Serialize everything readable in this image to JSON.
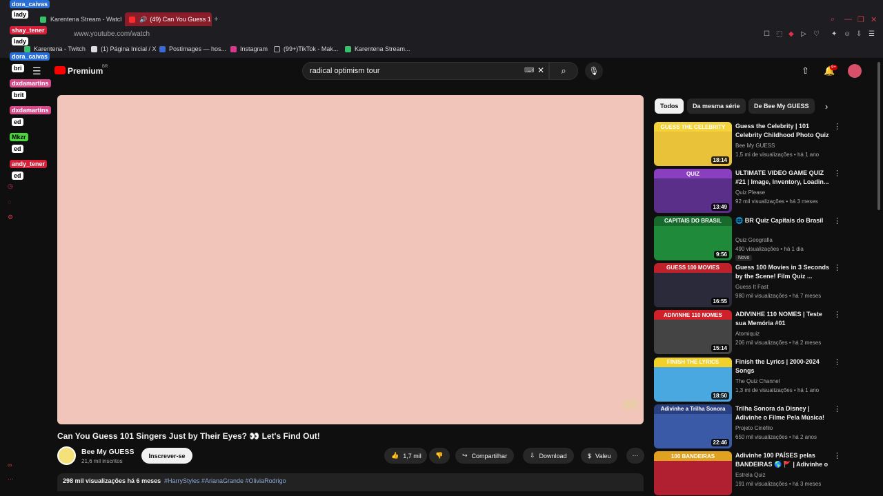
{
  "browser": {
    "tabs": [
      {
        "label": "Karentena Stream - Watch"
      },
      {
        "label": "(49) Can You Guess 1"
      }
    ],
    "new_tab": "+",
    "url": "www.youtube.com/watch",
    "bookmarks": [
      {
        "label": "Karentena - Twitch"
      },
      {
        "label": "(1) Página Inicial / X"
      },
      {
        "label": "Postimages — hos..."
      },
      {
        "label": "Instagram"
      },
      {
        "label": "(99+)TikTok - Mak..."
      },
      {
        "label": "Karentena Stream..."
      }
    ]
  },
  "yt": {
    "logo_text": "Premium",
    "logo_region": "BR",
    "search_value": "radical optimism tour",
    "notif_count": "9+"
  },
  "video": {
    "title": "Can You Guess 101 Singers Just by Their Eyes? 👀 Let's Find Out!",
    "channel": "Bee My GUESS",
    "subs": "21,6 mil inscritos",
    "subscribe": "Inscrever-se",
    "likes": "1,7 mil",
    "share": "Compartilhar",
    "download": "Download",
    "thanks": "Valeu",
    "views_line": "298 mil visualizações  há 6 meses",
    "tags": "#HarryStyles #ArianaGrande #OliviaRodrigo"
  },
  "chips": [
    "Todos",
    "Da mesma série",
    "De Bee My GUESS"
  ],
  "recs": [
    {
      "title": "Guess the Celebrity | 101 Celebrity Childhood Photo Quiz",
      "channel": "Bee My GUESS",
      "meta": "1,5 mi de visualizações • há 1 ano",
      "dur": "18:14",
      "thumb_label": "GUESS THE CELEBRITY",
      "color": "#e9c23a",
      "band": "#f4d23a"
    },
    {
      "title": "ULTIMATE VIDEO GAME QUIZ #21 | Image, Inventory, Loadin...",
      "channel": "Quiz Please",
      "meta": "92 mil visualizações • há 3 meses",
      "dur": "13:49",
      "thumb_label": "QUIZ",
      "color": "#5a2f8a",
      "band": "#8a3fc0"
    },
    {
      "title": "🌐 BR Quiz Capitais do Brasil",
      "channel": "Quiz Geografia",
      "meta": "490 visualizações • há 1 dia",
      "dur": "9:56",
      "thumb_label": "CAPITAIS DO BRASIL",
      "color": "#1f8a3a",
      "band": "#176a2c",
      "new": "Novo"
    },
    {
      "title": "Guess 100 Movies in 3 Seconds by the Scene! Film Quiz ...",
      "channel": "Guess It Fast",
      "meta": "980 mil visualizações • há 7 meses",
      "dur": "16:55",
      "thumb_label": "GUESS 100 MOVIES",
      "color": "#2a2a3a",
      "band": "#c0202a"
    },
    {
      "title": "ADIVINHE 110 NOMES | Teste sua Memória #01",
      "channel": "Atomiquiz",
      "meta": "206 mil visualizações • há 2 meses",
      "dur": "15:14",
      "thumb_label": "ADIVINHE 110 NOMES",
      "color": "#444",
      "band": "#d0202a"
    },
    {
      "title": "Finish the Lyrics | 2000-2024 Songs",
      "channel": "The Quiz Channel",
      "meta": "1,3 mi de visualizações • há 1 ano",
      "dur": "18:50",
      "thumb_label": "FINISH THE LYRICS",
      "color": "#4aa8e0",
      "band": "#f2d12a"
    },
    {
      "title": "Trilha Sonora da Disney | Adivinhe o Filme Pela Música!",
      "channel": "Projeto Cinéfilo",
      "meta": "650 mil visualizações • há 2 anos",
      "dur": "22:46",
      "thumb_label": "Adivinhe a Trilha Sonora",
      "color": "#3a5aa8",
      "band": "#2a3f80"
    },
    {
      "title": "Adivinhe 100 PAÍSES pelas BANDEIRAS 🌎 🚩 | Adivinhe o ...",
      "channel": "Estrela Quiz",
      "meta": "191 mil visualizações • há 3 meses",
      "dur": "",
      "thumb_label": "100 BANDEIRAS",
      "color": "#b02030",
      "band": "#e0a020"
    }
  ],
  "chat": [
    {
      "text": "dora_caivas",
      "color": "#2a6fd6",
      "fg": "#fff"
    },
    {
      "text": "lady",
      "color": "#ffffff",
      "fg": "#000"
    },
    {
      "text": "shay_tener",
      "color": "#d6203a",
      "fg": "#fff"
    },
    {
      "text": "lady",
      "color": "#ffffff",
      "fg": "#000"
    },
    {
      "text": "dora_caivas",
      "color": "#2a6fd6",
      "fg": "#fff"
    },
    {
      "text": "bri",
      "color": "#ffffff",
      "fg": "#000"
    },
    {
      "text": "dxdamartins",
      "color": "#d64a8a",
      "fg": "#fff"
    },
    {
      "text": "brit",
      "color": "#ffffff",
      "fg": "#000"
    },
    {
      "text": "dxdamartins",
      "color": "#d64a8a",
      "fg": "#fff"
    },
    {
      "text": "ed",
      "color": "#ffffff",
      "fg": "#000"
    },
    {
      "text": "Mkzr",
      "color": "#4ad63a",
      "fg": "#000"
    },
    {
      "text": "ed",
      "color": "#ffffff",
      "fg": "#000"
    },
    {
      "text": "andy_tener",
      "color": "#d6203a",
      "fg": "#fff"
    },
    {
      "text": "ed",
      "color": "#ffffff",
      "fg": "#000"
    }
  ]
}
